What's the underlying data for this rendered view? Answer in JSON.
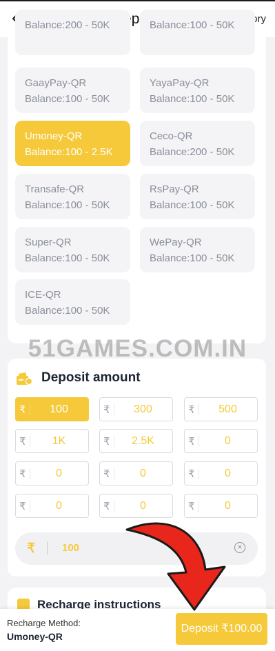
{
  "header": {
    "back_icon": "chevron-left-icon",
    "title": "Deposit",
    "history_link": "Deposit history"
  },
  "channels": [
    {
      "name": "",
      "balance": "Balance:200 - 50K",
      "active": false
    },
    {
      "name": "",
      "balance": "Balance:100 - 50K",
      "active": false
    },
    {
      "name": "GaayPay-QR",
      "balance": "Balance:100 - 50K",
      "active": false
    },
    {
      "name": "YayaPay-QR",
      "balance": "Balance:100 - 50K",
      "active": false
    },
    {
      "name": "Umoney-QR",
      "balance": "Balance:100 - 2.5K",
      "active": true
    },
    {
      "name": "Ceco-QR",
      "balance": "Balance:200 - 50K",
      "active": false
    },
    {
      "name": "Transafe-QR",
      "balance": "Balance:100 - 50K",
      "active": false
    },
    {
      "name": "RsPay-QR",
      "balance": "Balance:100 - 50K",
      "active": false
    },
    {
      "name": "Super-QR",
      "balance": "Balance:100 - 50K",
      "active": false
    },
    {
      "name": "WePay-QR",
      "balance": "Balance:100 - 50K",
      "active": false
    },
    {
      "name": "ICE-QR",
      "balance": "Balance:100 - 50K",
      "active": false
    }
  ],
  "watermark": "51GAMES.COM.IN",
  "deposit_amount": {
    "title": "Deposit amount",
    "icon": "wallet-icon",
    "currency_symbol": "₹",
    "options": [
      {
        "value": "100",
        "selected": true
      },
      {
        "value": "300",
        "selected": false
      },
      {
        "value": "500",
        "selected": false
      },
      {
        "value": "1K",
        "selected": false
      },
      {
        "value": "2.5K",
        "selected": false
      },
      {
        "value": "0",
        "selected": false
      },
      {
        "value": "0",
        "selected": false
      },
      {
        "value": "0",
        "selected": false
      },
      {
        "value": "0",
        "selected": false
      },
      {
        "value": "0",
        "selected": false
      },
      {
        "value": "0",
        "selected": false
      },
      {
        "value": "0",
        "selected": false
      }
    ],
    "input": {
      "currency": "₹",
      "value": "100",
      "clear_icon": "clear-circle-icon"
    }
  },
  "instructions": {
    "title": "Recharge instructions",
    "icon": "document-icon"
  },
  "bottom_bar": {
    "method_label": "Recharge Method:",
    "method_value": "Umoney-QR",
    "deposit_button": "Deposit ₹100.00"
  },
  "colors": {
    "accent": "#f5c93a",
    "arrow": "#e8261c",
    "background": "#f3f3f6"
  }
}
